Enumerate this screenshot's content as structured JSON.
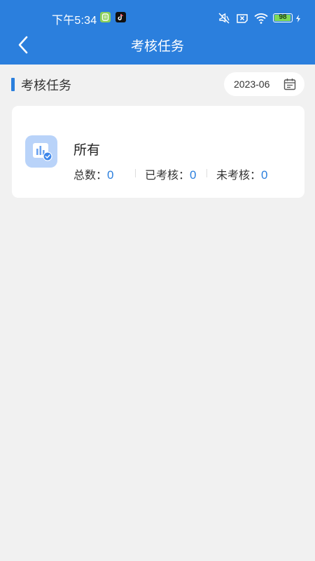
{
  "status_bar": {
    "time": "下午5:34",
    "battery": "98",
    "icons": [
      "app-icon-green",
      "tiktok-icon",
      "mute-icon",
      "sim-off-icon",
      "wifi-icon",
      "battery-icon",
      "charging-icon"
    ]
  },
  "nav": {
    "title": "考核任务",
    "back_icon": "chevron-left-icon"
  },
  "section": {
    "title": "考核任务",
    "date": "2023-06",
    "date_icon": "calendar-icon"
  },
  "card": {
    "title": "所有",
    "icon": "chart-check-icon",
    "stats": [
      {
        "label": "总数：",
        "value": "0"
      },
      {
        "label": "已考核：",
        "value": "0"
      },
      {
        "label": "未考核：",
        "value": "0"
      }
    ]
  },
  "colors": {
    "primary": "#2b7fdd",
    "background": "#f1f1f1",
    "card": "#ffffff",
    "battery_fill": "#7ed957"
  }
}
